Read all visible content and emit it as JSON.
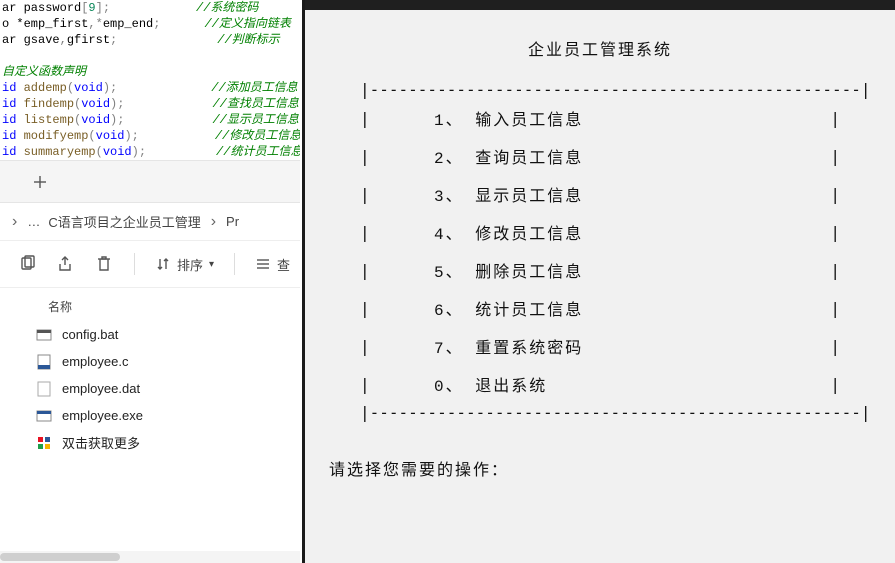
{
  "code": {
    "lines": [
      {
        "pre": "ar ",
        "ident": "password",
        "post": "[",
        "num": "9",
        "post2": "];",
        "cmt": "//系统密码"
      },
      {
        "pre": "o *",
        "ident": "emp_first",
        "post": ",*",
        "ident2": "emp_end",
        "post2": ";",
        "cmt": "//定义指向链表"
      },
      {
        "pre": "ar ",
        "ident": "gsave",
        "post": ",",
        "ident2": "gfirst",
        "post2": ";",
        "cmt": "//判断标示"
      }
    ],
    "blank": "",
    "section_comment": "自定义函数声明",
    "decls": [
      {
        "ret": "id ",
        "name": "addemp",
        "arg": "void",
        "cmt": "//添加员工信息"
      },
      {
        "ret": "id ",
        "name": "findemp",
        "arg": "void",
        "cmt": "//查找员工信息"
      },
      {
        "ret": "id ",
        "name": "listemp",
        "arg": "void",
        "cmt": "//显示员工信息"
      },
      {
        "ret": "id ",
        "name": "modifyemp",
        "arg": "void",
        "cmt": "//修改员工信息"
      },
      {
        "ret": "id ",
        "name": "summaryemp",
        "arg": "void",
        "cmt": "//统计员工信息"
      }
    ]
  },
  "breadcrumb": {
    "ellipsis": "…",
    "folder": "C语言项目之企业员工管理",
    "sub": "Pr"
  },
  "toolbar": {
    "sort_label": "排序",
    "view_label": "查"
  },
  "filelist": {
    "header": "名称",
    "rows": [
      {
        "icon": "bat",
        "name": "config.bat"
      },
      {
        "icon": "c",
        "name": "employee.c"
      },
      {
        "icon": "dat",
        "name": "employee.dat"
      },
      {
        "icon": "exe",
        "name": "employee.exe"
      },
      {
        "icon": "more",
        "name": "双击获取更多"
      }
    ]
  },
  "console": {
    "title": "企业员工管理系统",
    "menu": [
      "1、 输入员工信息",
      "2、 查询员工信息",
      "3、 显示员工信息",
      "4、 修改员工信息",
      "5、 删除员工信息",
      "6、 统计员工信息",
      "7、 重置系统密码",
      "0、 退出系统"
    ],
    "prompt": "请选择您需要的操作："
  }
}
